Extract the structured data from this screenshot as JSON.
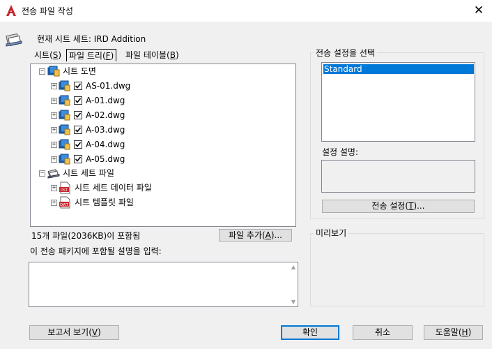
{
  "window": {
    "title": "전송 파일 작성",
    "close_glyph": "✕"
  },
  "current_sheetset": "현재 시트 세트: IRD Addition",
  "tabs": [
    {
      "label": "시트(",
      "key": "S",
      "suffix": ")",
      "active": false
    },
    {
      "label": "파일 트리(",
      "key": "F",
      "suffix": ")",
      "active": true
    },
    {
      "label": "파일 테이블(",
      "key": "B",
      "suffix": ")",
      "active": false
    }
  ],
  "tree": {
    "sheet_drawings": {
      "label": "시트 도면",
      "files": [
        "AS-01.dwg",
        "A-01.dwg",
        "A-02.dwg",
        "A-03.dwg",
        "A-04.dwg",
        "A-05.dwg"
      ]
    },
    "sheetset_files": {
      "label": "시트 세트 파일",
      "children": [
        {
          "label": "시트 세트 데이터 파일",
          "icon": "dst-file-icon",
          "badge": "DST"
        },
        {
          "label": "시트 템플릿 파일",
          "icon": "dwt-file-icon",
          "badge": "DWT"
        }
      ]
    }
  },
  "file_count": "15개 파일(2036KB)이 포함됨",
  "add_file_button": {
    "label": "파일 추가(",
    "key": "A",
    "suffix": ")..."
  },
  "description_label": "이 전송 패키지에 포함될 설명을 입력:",
  "description_value": "",
  "transmittal_setup": {
    "group_title": "전송 설정을 선택",
    "items": [
      "Standard"
    ],
    "selected": "Standard",
    "desc_label": "설정 설명:",
    "setup_button": {
      "label": "전송 설정(",
      "key": "T",
      "suffix": ")..."
    }
  },
  "preview_group_title": "미리보기",
  "footer": {
    "report_button": {
      "label": "보고서 보기(",
      "key": "V",
      "suffix": ")"
    },
    "ok_button": "확인",
    "cancel_button": "취소",
    "help_button": {
      "label": "도움말(",
      "key": "H",
      "suffix": ")"
    }
  },
  "colors": {
    "accent": "#0078d7",
    "autocad_red": "#c6262e"
  }
}
